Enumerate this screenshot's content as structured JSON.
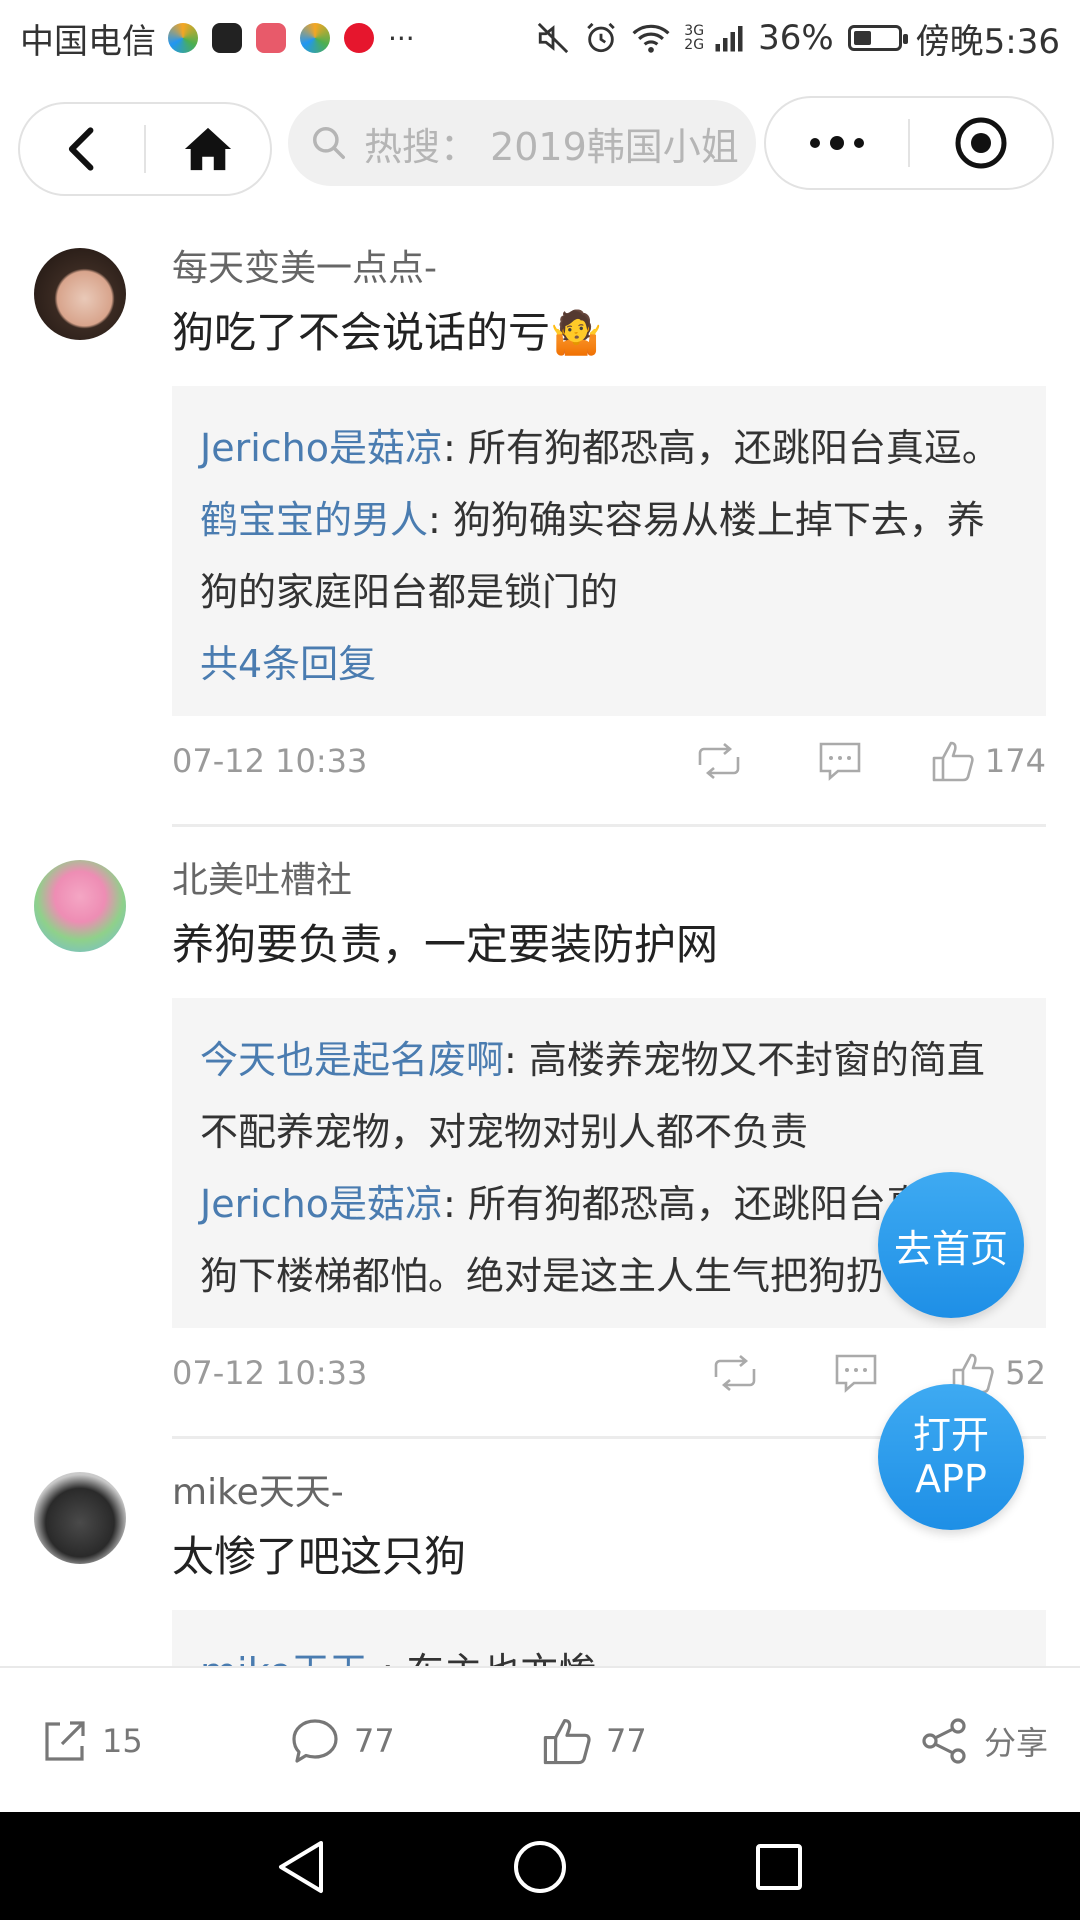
{
  "status_bar": {
    "carrier": "中国电信",
    "more": "···",
    "net_top": "3G",
    "net_bottom": "2G",
    "battery": "36%",
    "time": "傍晚5:36",
    "battery_level": 0.36
  },
  "nav": {
    "search_placeholder": "热搜： 2019韩国小姐"
  },
  "comments": [
    {
      "author": "每天变美一点点-",
      "text": "狗吃了不会说话的亏🤷",
      "replies": [
        {
          "name": "Jericho是菇凉",
          "text": ": 所有狗都恐高，还跳阳台真逗。"
        },
        {
          "name": "鹤宝宝的男人",
          "text": ": 狗狗确实容易从楼上掉下去，养狗的家庭阳台都是锁门的"
        }
      ],
      "more_replies": "共4条回复",
      "time": "07-12 10:33",
      "likes": "174"
    },
    {
      "author": "北美吐槽社",
      "text": "养狗要负责，一定要装防护网",
      "replies": [
        {
          "name": "今天也是起名废啊",
          "text": ": 高楼养宠物又不封窗的简直不配养宠物，对宠物对别人都不负责"
        },
        {
          "name": "Jericho是菇凉",
          "text": ": 所有狗都恐高，还跳阳台真逗。狗下楼梯都怕。绝对是这主人生气把狗扔下去的"
        }
      ],
      "time": "07-12 10:33",
      "likes": "52"
    },
    {
      "author": "mike天天-",
      "text": "太惨了吧这只狗",
      "replies": [
        {
          "name": "mike天天-",
          "text": ": 东主也亦惨"
        }
      ]
    }
  ],
  "fab": {
    "home": "去首页",
    "open_app_line1": "打开",
    "open_app_line2": "APP"
  },
  "bottom_bar": {
    "repost_count": "15",
    "comment_count": "77",
    "like_count": "77",
    "share_label": "分享"
  },
  "colors": {
    "link_blue": "#4a7cb0",
    "fab_blue": "#2a9cf0",
    "reply_bg": "#f5f5f5"
  }
}
